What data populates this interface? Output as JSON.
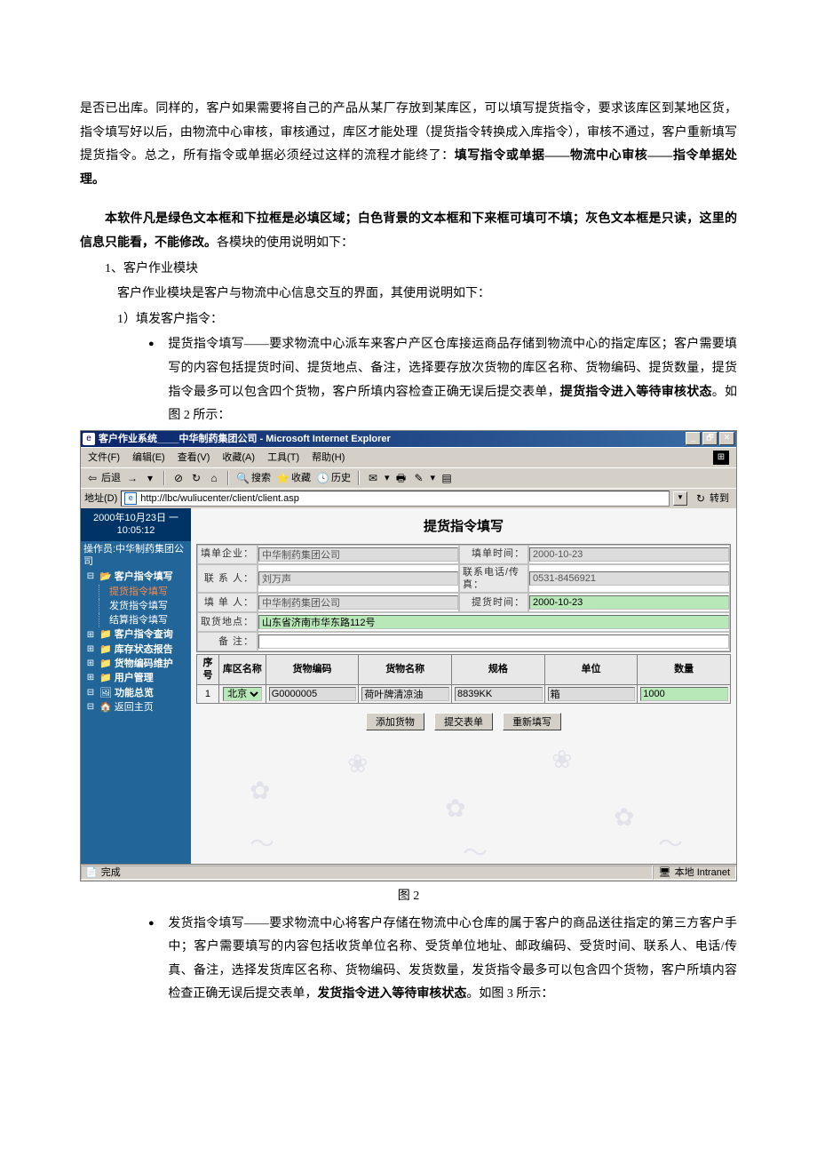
{
  "doc": {
    "p1": "是否已出库。同样的，客户如果需要将自己的产品从某厂存放到某库区，可以填写提货指令，要求该库区到某地区货，指令填写好以后，由物流中心审核，审核通过，库区才能处理（提货指令转换成入库指令），审核不通过，客户重新填写提货指令。总之，所有指令或单据必须经过这样的流程才能终了：",
    "p1_bold": "填写指令或单据——物流中心审核——指令单据处理。",
    "p2_bold": "本软件凡是绿色文本框和下拉框是必填区域；白色背景的文本框和下来框可填可不填；灰色文本框是只读，这里的信息只能看，不能修改。",
    "p2_tail": "各模块的使用说明如下：",
    "m1": "1、客户作业模块",
    "m1_desc": "客户作业模块是客户与物流中心信息交互的界面，其使用说明如下：",
    "m1_1": "1）填发客户指令：",
    "bullet1a": "提货指令填写——要求物流中心派车来客户产区仓库接运商品存储到物流中心的指定库区；客户需要填写的内容包括提货时间、提货地点、备注，选择要存放次货物的库区名称、货物编码、提货数量，提货指令最多可以包含四个货物，客户所填内容检查正确无误后提交表单，",
    "bullet1a_bold": "提货指令进入等待审核状态",
    "bullet1a_tail": "。如图 2 所示：",
    "figure2": "图 2",
    "bullet1b": "发货指令填写——要求物流中心将客户存储在物流中心仓库的属于客户的商品送往指定的第三方客户手中；客户需要填写的内容包括收货单位名称、受货单位地址、邮政编码、受货时间、联系人、电话/传真、备注，选择发货库区名称、货物编码、发货数量，发货指令最多可以包含四个货物，客户所填内容检查正确无误后提交表单，",
    "bullet1b_bold": "发货指令进入等待审核状态",
    "bullet1b_tail": "。如图 3 所示："
  },
  "ie": {
    "title": "客户作业系统____中华制药集团公司 - Microsoft Internet Explorer",
    "menus": {
      "file": "文件(F)",
      "edit": "编辑(E)",
      "view": "查看(V)",
      "fav": "收藏(A)",
      "tools": "工具(T)",
      "help": "帮助(H)"
    },
    "toolbar": {
      "back": "后退",
      "stop": "",
      "refresh": "",
      "home": "",
      "search": "搜索",
      "fav": "收藏",
      "history": "历史"
    },
    "address_label": "地址(D)",
    "address_url": "http://lbc/wuliucenter/client/client.asp",
    "go_label": "转到",
    "status_done": "完成",
    "status_zone": "本地 Intranet"
  },
  "sidebar": {
    "date": "2000年10月23日 一",
    "time": "10:05:12",
    "operator": "操作员:中华制药集团公司",
    "items": [
      {
        "label": "客户指令填写",
        "sub": [
          {
            "label": "提货指令填写",
            "active": true
          },
          {
            "label": "发货指令填写"
          },
          {
            "label": "结算指令填写"
          }
        ]
      },
      {
        "label": "客户指令查询"
      },
      {
        "label": "库存状态报告"
      },
      {
        "label": "货物编码维护"
      },
      {
        "label": "用户管理"
      },
      {
        "label": "功能总览"
      },
      {
        "label": "返回主页"
      }
    ]
  },
  "form": {
    "title": "提货指令填写",
    "labels": {
      "fill_company": "填单企业：",
      "fill_time": "填单时间：",
      "contact": "联 系 人：",
      "phone": "联系电话/传真：",
      "pickup_person": "填 单 人：",
      "pickup_time": "提货时间：",
      "pickup_loc": "取货地点：",
      "remark": "备    注："
    },
    "values": {
      "fill_company": "中华制药集团公司",
      "fill_time": "2000-10-23",
      "contact": "刘万声",
      "phone": "0531-8456921",
      "pickup_person": "中华制药集团公司",
      "pickup_time": "2000-10-23",
      "pickup_loc": "山东省济南市华东路112号",
      "remark": ""
    },
    "table": {
      "headers": [
        "序号",
        "库区名称",
        "货物编码",
        "货物名称",
        "规格",
        "单位",
        "数量"
      ],
      "row": {
        "seq": "1",
        "warehouse": "北京库区",
        "code": "G0000005",
        "name": "荷叶牌清凉油",
        "spec": "8839KK",
        "unit": "箱",
        "qty": "1000"
      }
    },
    "buttons": {
      "add": "添加货物",
      "submit": "提交表单",
      "reset": "重新填写"
    }
  }
}
